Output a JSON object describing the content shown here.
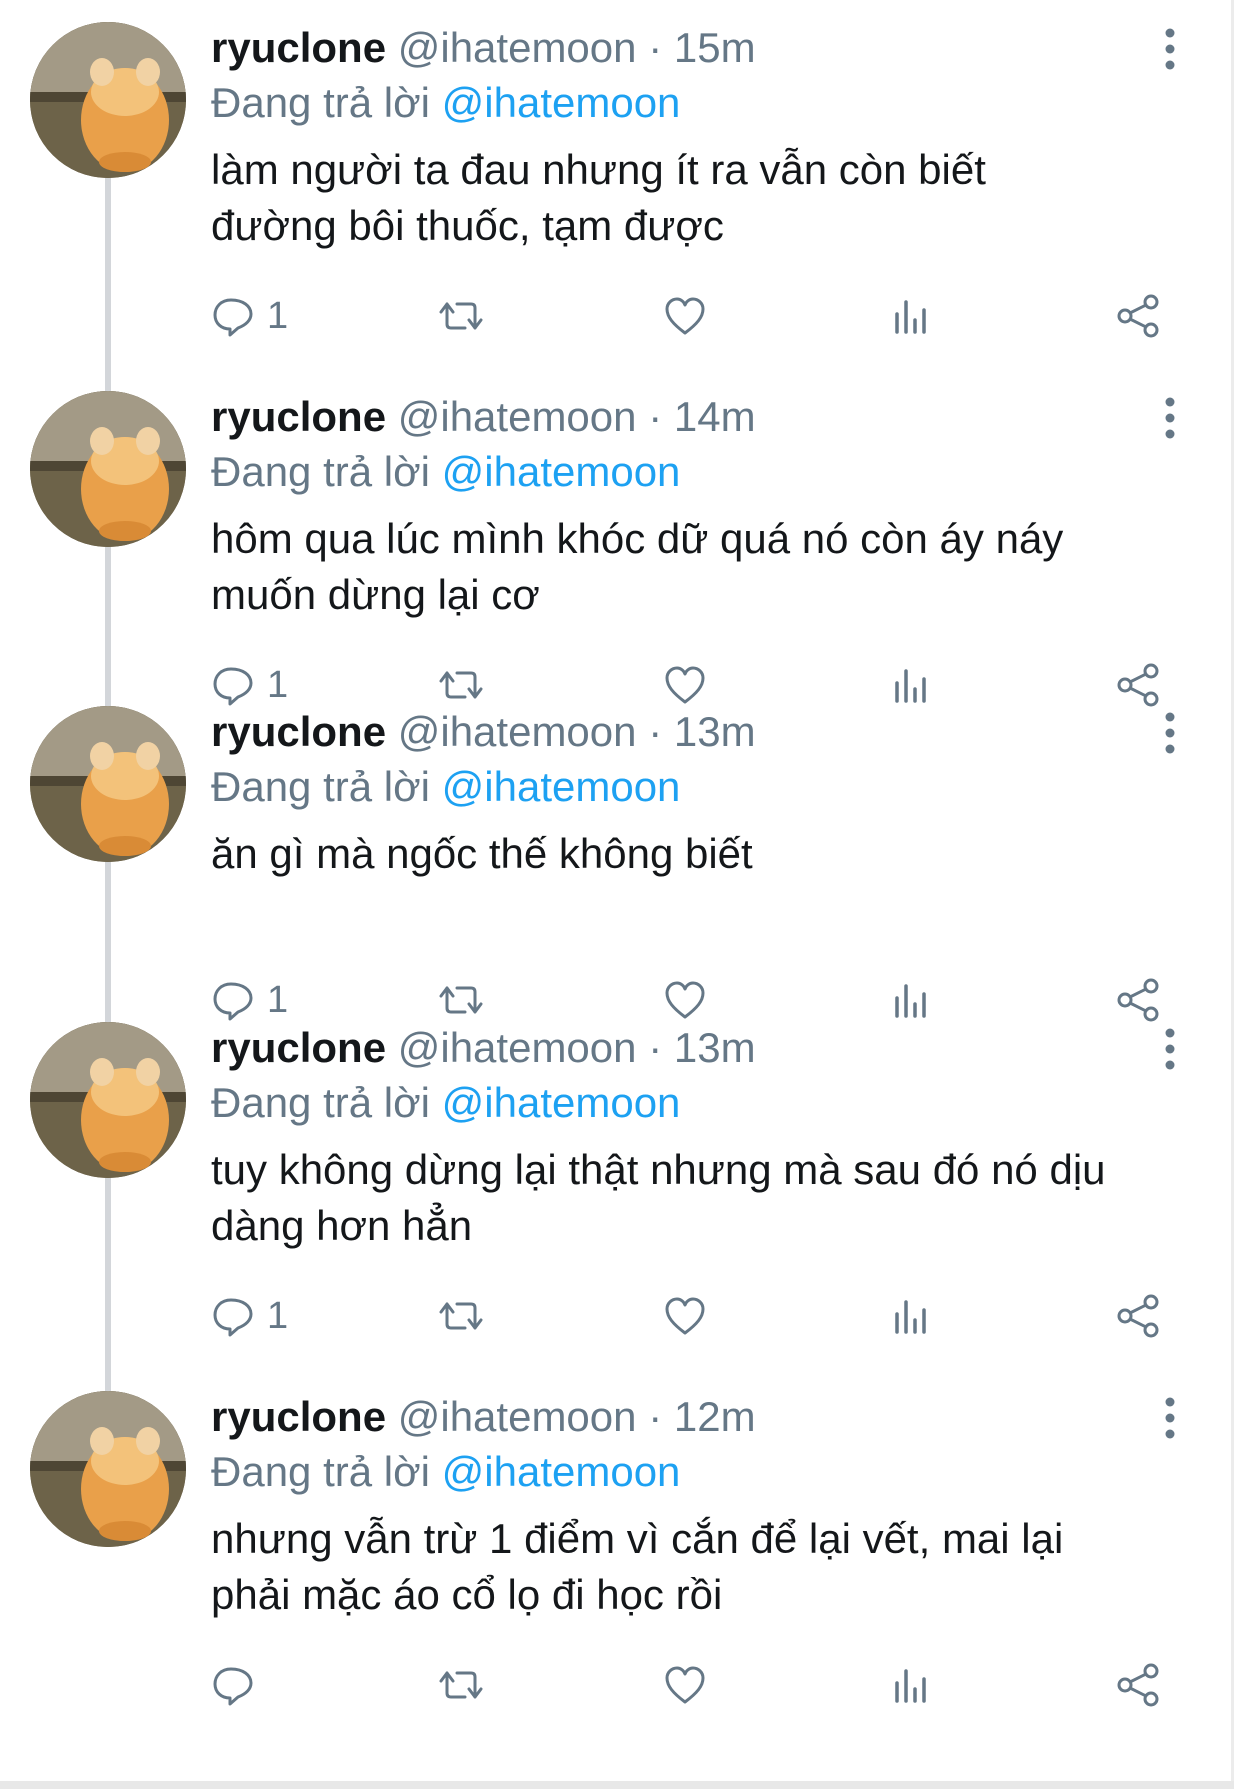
{
  "colors": {
    "accent": "#1da1f2",
    "secondary_text": "#657786",
    "thread_line": "#d3d6da"
  },
  "icons": {
    "reply": "reply-icon",
    "retweet": "retweet-icon",
    "like": "heart-icon",
    "analytics": "analytics-icon",
    "share": "share-icon",
    "more": "more-vertical-icon"
  },
  "tweets": [
    {
      "name": "ryuclone",
      "handle": "@ihatemoon",
      "sep": "·",
      "time": "15m",
      "reply_prefix": "Đang trả lời",
      "reply_to": "@ihatemoon",
      "lines": [
        "làm người ta đau nhưng ít ra vẫn còn biết",
        "đường bôi thuốc, tạm được"
      ],
      "reply_count": "1"
    },
    {
      "name": "ryuclone",
      "handle": "@ihatemoon",
      "sep": "·",
      "time": "14m",
      "reply_prefix": "Đang trả lời",
      "reply_to": "@ihatemoon",
      "lines": [
        "hôm qua lúc mình khóc dữ quá nó còn áy náy",
        "muốn dừng lại cơ"
      ],
      "reply_count": "1"
    },
    {
      "name": "ryuclone",
      "handle": "@ihatemoon",
      "sep": "·",
      "time": "13m",
      "reply_prefix": "Đang trả lời",
      "reply_to": "@ihatemoon",
      "lines": [
        "ăn gì mà ngốc thế không biết"
      ],
      "reply_count": "1"
    },
    {
      "name": "ryuclone",
      "handle": "@ihatemoon",
      "sep": "·",
      "time": "13m",
      "reply_prefix": "Đang trả lời",
      "reply_to": "@ihatemoon",
      "lines": [
        "tuy không dừng lại thật nhưng mà sau đó nó dịu",
        "dàng hơn hẳn"
      ],
      "reply_count": "1"
    },
    {
      "name": "ryuclone",
      "handle": "@ihatemoon",
      "sep": "·",
      "time": "12m",
      "reply_prefix": "Đang trả lời",
      "reply_to": "@ihatemoon",
      "lines": [
        "nhưng vẫn trừ 1 điểm vì cắn để lại vết, mai lại",
        "phải mặc áo cổ lọ đi học rồi"
      ],
      "reply_count": ""
    }
  ]
}
